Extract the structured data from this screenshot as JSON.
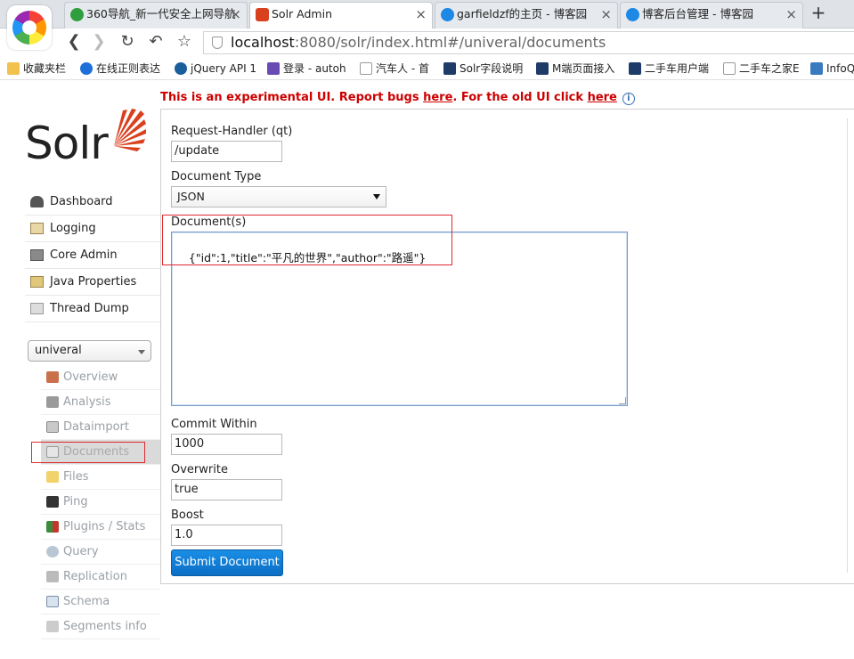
{
  "browser": {
    "tabs": [
      {
        "title": "360导航_新一代安全上网导航"
      },
      {
        "title": "Solr Admin"
      },
      {
        "title": "garfieldzf的主页 - 博客园"
      },
      {
        "title": "博客后台管理 - 博客园"
      }
    ],
    "new_tab": "+",
    "address": {
      "host": "localhost",
      "rest": ":8080/solr/index.html#/univeral/documents"
    },
    "bookmarks": [
      {
        "label": "收藏夹栏"
      },
      {
        "label": "在线正则表达"
      },
      {
        "label": "jQuery API 1"
      },
      {
        "label": "登录 - autoh"
      },
      {
        "label": "汽车人 - 首"
      },
      {
        "label": "Solr字段说明"
      },
      {
        "label": "M端页面接入"
      },
      {
        "label": "二手车用户端"
      },
      {
        "label": "二手车之家E"
      },
      {
        "label": "InfoQ"
      }
    ]
  },
  "banner": {
    "prefix": "This is an experimental UI. Report bugs ",
    "link1": "here",
    "middle": ". For the old UI click ",
    "link2": "here"
  },
  "logo": {
    "word": "Solr"
  },
  "nav": {
    "items": [
      {
        "label": "Dashboard",
        "icon": "dashboard-icon"
      },
      {
        "label": "Logging",
        "icon": "logging-icon"
      },
      {
        "label": "Core Admin",
        "icon": "core-admin-icon"
      },
      {
        "label": "Java Properties",
        "icon": "java-icon"
      },
      {
        "label": "Thread Dump",
        "icon": "thread-dump-icon"
      }
    ]
  },
  "core_selector": {
    "value": "univeral"
  },
  "core_menu": {
    "items": [
      {
        "label": "Overview"
      },
      {
        "label": "Analysis"
      },
      {
        "label": "Dataimport"
      },
      {
        "label": "Documents"
      },
      {
        "label": "Files"
      },
      {
        "label": "Ping"
      },
      {
        "label": "Plugins / Stats"
      },
      {
        "label": "Query"
      },
      {
        "label": "Replication"
      },
      {
        "label": "Schema"
      },
      {
        "label": "Segments info"
      }
    ]
  },
  "form": {
    "handler_label": "Request-Handler (qt)",
    "handler_value": "/update",
    "doctype_label": "Document Type",
    "doctype_value": "JSON",
    "documents_label": "Document(s)",
    "documents_value": "{\"id\":1,\"title\":\"平凡的世界\",\"author\":\"路遥\"}",
    "commit_label": "Commit Within",
    "commit_value": "1000",
    "overwrite_label": "Overwrite",
    "overwrite_value": "true",
    "boost_label": "Boost",
    "boost_value": "1.0",
    "submit_label": "Submit Document"
  },
  "colors": {
    "brand": "#d9411e",
    "banner": "#cc0000",
    "highlight": "#e0282e",
    "button": "#0b6ec4"
  }
}
